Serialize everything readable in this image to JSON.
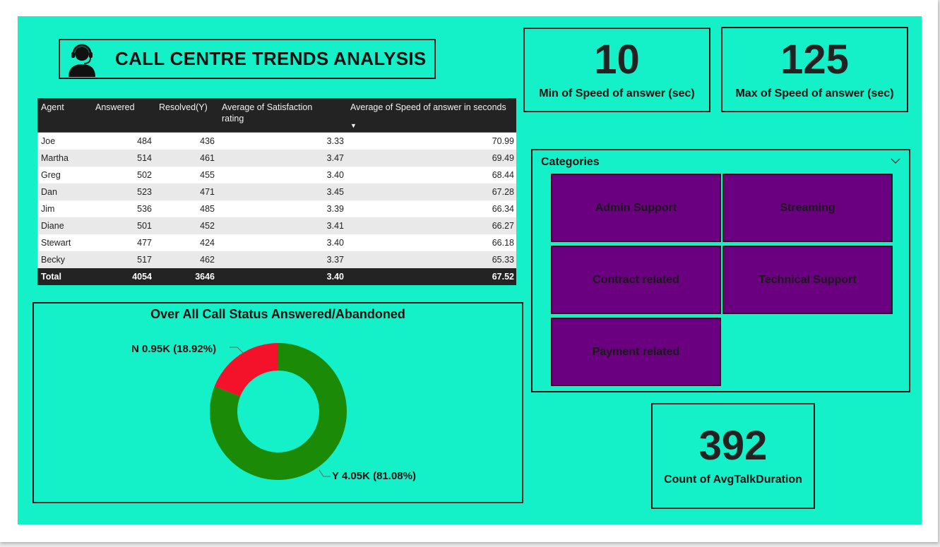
{
  "header": {
    "title": "CALL CENTRE TRENDS ANALYSIS",
    "icon": "call-centre-agent-icon"
  },
  "kpis": {
    "min_speed": {
      "value": "10",
      "label": "Min of Speed of answer (sec)"
    },
    "max_speed": {
      "value": "125",
      "label": "Max of Speed of answer (sec)"
    },
    "avg_talk": {
      "value": "392",
      "label": "Count of AvgTalkDuration"
    }
  },
  "table": {
    "columns": [
      "Agent",
      "Answered",
      "Resolved(Y)",
      "Average of Satisfaction rating",
      "Average of Speed of answer in seconds"
    ],
    "sort_column": "Average of Speed of answer in seconds",
    "sort_direction": "descending",
    "rows": [
      [
        "Joe",
        "484",
        "436",
        "3.33",
        "70.99"
      ],
      [
        "Martha",
        "514",
        "461",
        "3.47",
        "69.49"
      ],
      [
        "Greg",
        "502",
        "455",
        "3.40",
        "68.44"
      ],
      [
        "Dan",
        "523",
        "471",
        "3.45",
        "67.28"
      ],
      [
        "Jim",
        "536",
        "485",
        "3.39",
        "66.34"
      ],
      [
        "Diane",
        "501",
        "452",
        "3.41",
        "66.27"
      ],
      [
        "Stewart",
        "477",
        "424",
        "3.40",
        "66.18"
      ],
      [
        "Becky",
        "517",
        "462",
        "3.37",
        "65.33"
      ]
    ],
    "total": [
      "Total",
      "4054",
      "3646",
      "3.40",
      "67.52"
    ]
  },
  "chart_data": {
    "type": "pie",
    "title": "Over All Call Status Answered/Abandoned",
    "slices": [
      {
        "name": "Y",
        "value": 4.05,
        "percent": 81.08,
        "label": "Y 4.05K (81.08%)",
        "color": "#1b8a06"
      },
      {
        "name": "N",
        "value": 0.95,
        "percent": 18.92,
        "label": "N 0.95K (18.92%)",
        "color": "#f3122a"
      }
    ],
    "donut": true
  },
  "categories": {
    "title": "Categories",
    "items": [
      "Admin Support",
      "Streaming",
      "Contract related",
      "Technical Support",
      "Payment related"
    ],
    "tile_color": "#6a0080"
  },
  "colors": {
    "background": "#14f0c8",
    "table_header": "#232323"
  }
}
